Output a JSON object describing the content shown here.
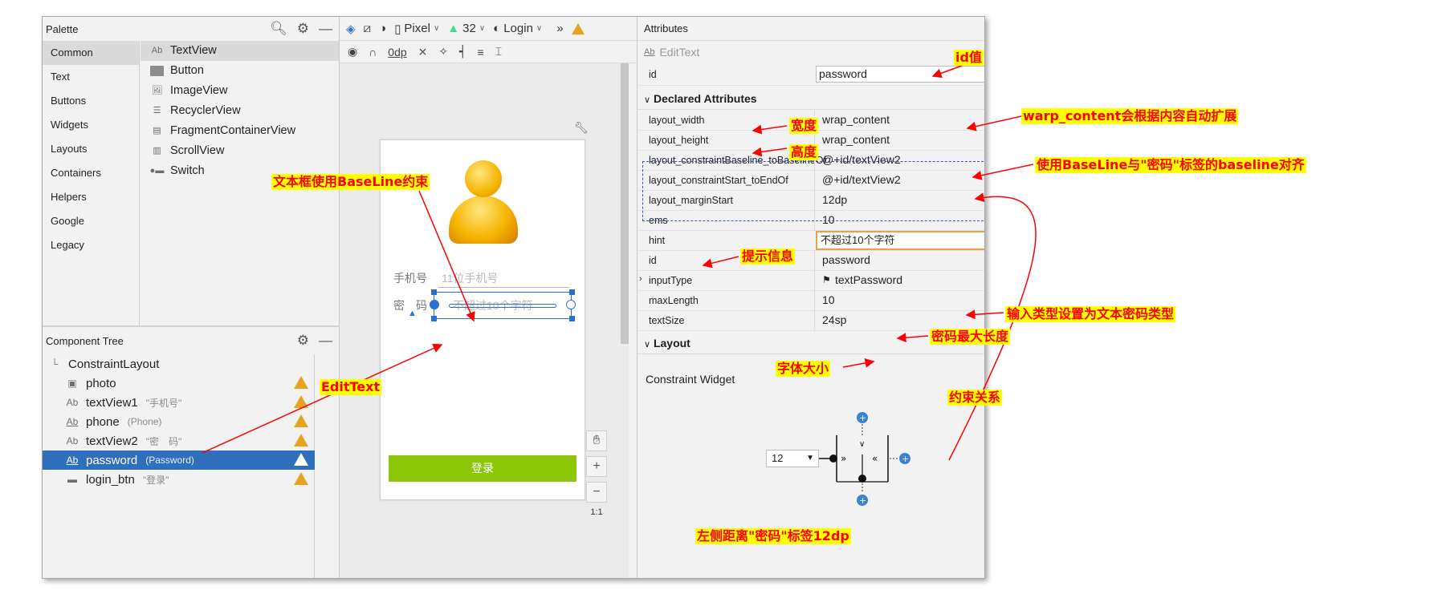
{
  "palette": {
    "title": "Palette",
    "categories": [
      "Common",
      "Text",
      "Buttons",
      "Widgets",
      "Layouts",
      "Containers",
      "Helpers",
      "Google",
      "Legacy"
    ],
    "widgets": [
      {
        "icon": "Ab",
        "label": "TextView"
      },
      {
        "icon": "button",
        "label": "Button"
      },
      {
        "icon": "image",
        "label": "ImageView"
      },
      {
        "icon": "list",
        "label": "RecyclerView"
      },
      {
        "icon": "fragment",
        "label": "FragmentContainerView"
      },
      {
        "icon": "scroll",
        "label": "ScrollView"
      },
      {
        "icon": "switch",
        "label": "Switch"
      }
    ]
  },
  "component_tree": {
    "title": "Component Tree",
    "root": "ConstraintLayout",
    "items": [
      {
        "icon": "image",
        "name": "photo",
        "sub": ""
      },
      {
        "icon": "Ab",
        "name": "textView1",
        "sub": "\"手机号\""
      },
      {
        "icon": "Ab",
        "name": "phone",
        "sub": "(Phone)"
      },
      {
        "icon": "Ab",
        "name": "textView2",
        "sub": "\"密　码\""
      },
      {
        "icon": "Ab",
        "name": "password",
        "sub": "(Password)"
      },
      {
        "icon": "button",
        "name": "login_btn",
        "sub": "\"登录\""
      }
    ]
  },
  "toolbar": {
    "device": "Pixel",
    "api": "32",
    "theme": "Login",
    "margin": "0dp",
    "more": "»"
  },
  "phone_preview": {
    "phone_label": "手机号",
    "phone_hint": "11位手机号",
    "pwd_label": "密　码",
    "pwd_hint": "不超过10个字符",
    "login": "登录"
  },
  "zoom": {
    "plus": "+",
    "minus": "−",
    "ratio": "1:1"
  },
  "attributes": {
    "title": "Attributes",
    "widget": "EditText",
    "id_key": "id",
    "id_value": "password",
    "declared_title": "Declared Attributes",
    "declared": [
      {
        "key": "layout_width",
        "value": "wrap_content"
      },
      {
        "key": "layout_height",
        "value": "wrap_content"
      },
      {
        "key": "layout_constraintBaseline_toBaselineOf",
        "value": "@+id/textView2"
      },
      {
        "key": "layout_constraintStart_toEndOf",
        "value": "@+id/textView2"
      },
      {
        "key": "layout_marginStart",
        "value": "12dp"
      },
      {
        "key": "ems",
        "value": "10"
      },
      {
        "key": "hint",
        "value": "不超过10个字符"
      },
      {
        "key": "id",
        "value": "password"
      },
      {
        "key": "inputType",
        "value": "textPassword"
      },
      {
        "key": "maxLength",
        "value": "10"
      },
      {
        "key": "textSize",
        "value": "24sp"
      }
    ],
    "layout_title": "Layout",
    "constraint_widget": "Constraint Widget",
    "margin_value": "12"
  },
  "annotations": {
    "id_value": "id值",
    "width": "宽度",
    "height": "高度",
    "wrap": "warp_content会根据内容自动扩展",
    "baseline": "使用BaseLine与\"密码\"标签的baseline对齐",
    "edit_baseline": "文本框使用BaseLine约束",
    "hint": "提示信息",
    "input_type": "输入类型设置为文本密码类型",
    "max_length": "密码最大长度",
    "text_size": "字体大小",
    "edittext": "EditText",
    "constraint": "约束关系",
    "left_margin": "左侧距离\"密码\"标签12dp"
  },
  "colors": {
    "annotation_text": "#ff0000",
    "annotation_bg": "#ffff00",
    "selection": "#2f6fbd",
    "login_button": "#8bc708",
    "warning": "#e8a320"
  }
}
